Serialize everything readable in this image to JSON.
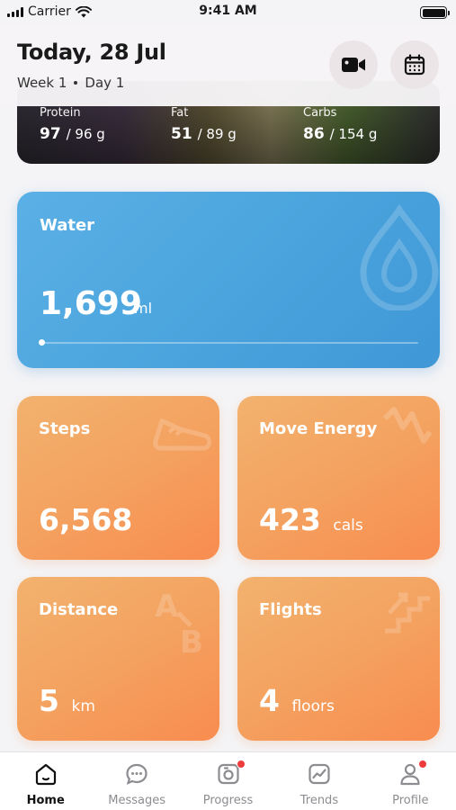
{
  "status_bar": {
    "carrier": "Carrier",
    "time": "9:41 AM"
  },
  "header": {
    "title": "Today, 28 Jul",
    "week": "Week 1",
    "day": "Day 1"
  },
  "food_card": {
    "macros": [
      {
        "label": "Protein",
        "value": "97",
        "target": "/ 96 g"
      },
      {
        "label": "Fat",
        "value": "51",
        "target": "/ 89 g"
      },
      {
        "label": "Carbs",
        "value": "86",
        "target": "/ 154 g"
      }
    ]
  },
  "water": {
    "title": "Water",
    "value": "1,699",
    "unit": "ml",
    "progress": 0.0
  },
  "tiles": {
    "steps": {
      "title": "Steps",
      "value": "6,568",
      "unit": ""
    },
    "move": {
      "title": "Move Energy",
      "value": "423",
      "unit": "cals"
    },
    "distance": {
      "title": "Distance",
      "value": "5",
      "unit": "km"
    },
    "flights": {
      "title": "Flights",
      "value": "4",
      "unit": "floors"
    }
  },
  "tab_bar": {
    "items": [
      {
        "label": "Home",
        "icon": "home-icon",
        "active": true,
        "badge": false
      },
      {
        "label": "Messages",
        "icon": "chat-icon",
        "active": false,
        "badge": false
      },
      {
        "label": "Progress",
        "icon": "camera-icon",
        "active": false,
        "badge": true
      },
      {
        "label": "Trends",
        "icon": "trend-icon",
        "active": false,
        "badge": false
      },
      {
        "label": "Profile",
        "icon": "person-icon",
        "active": false,
        "badge": true
      }
    ]
  },
  "colors": {
    "water": "#4da6de",
    "tile": "#f4a260",
    "badge": "#ef3b3b"
  }
}
